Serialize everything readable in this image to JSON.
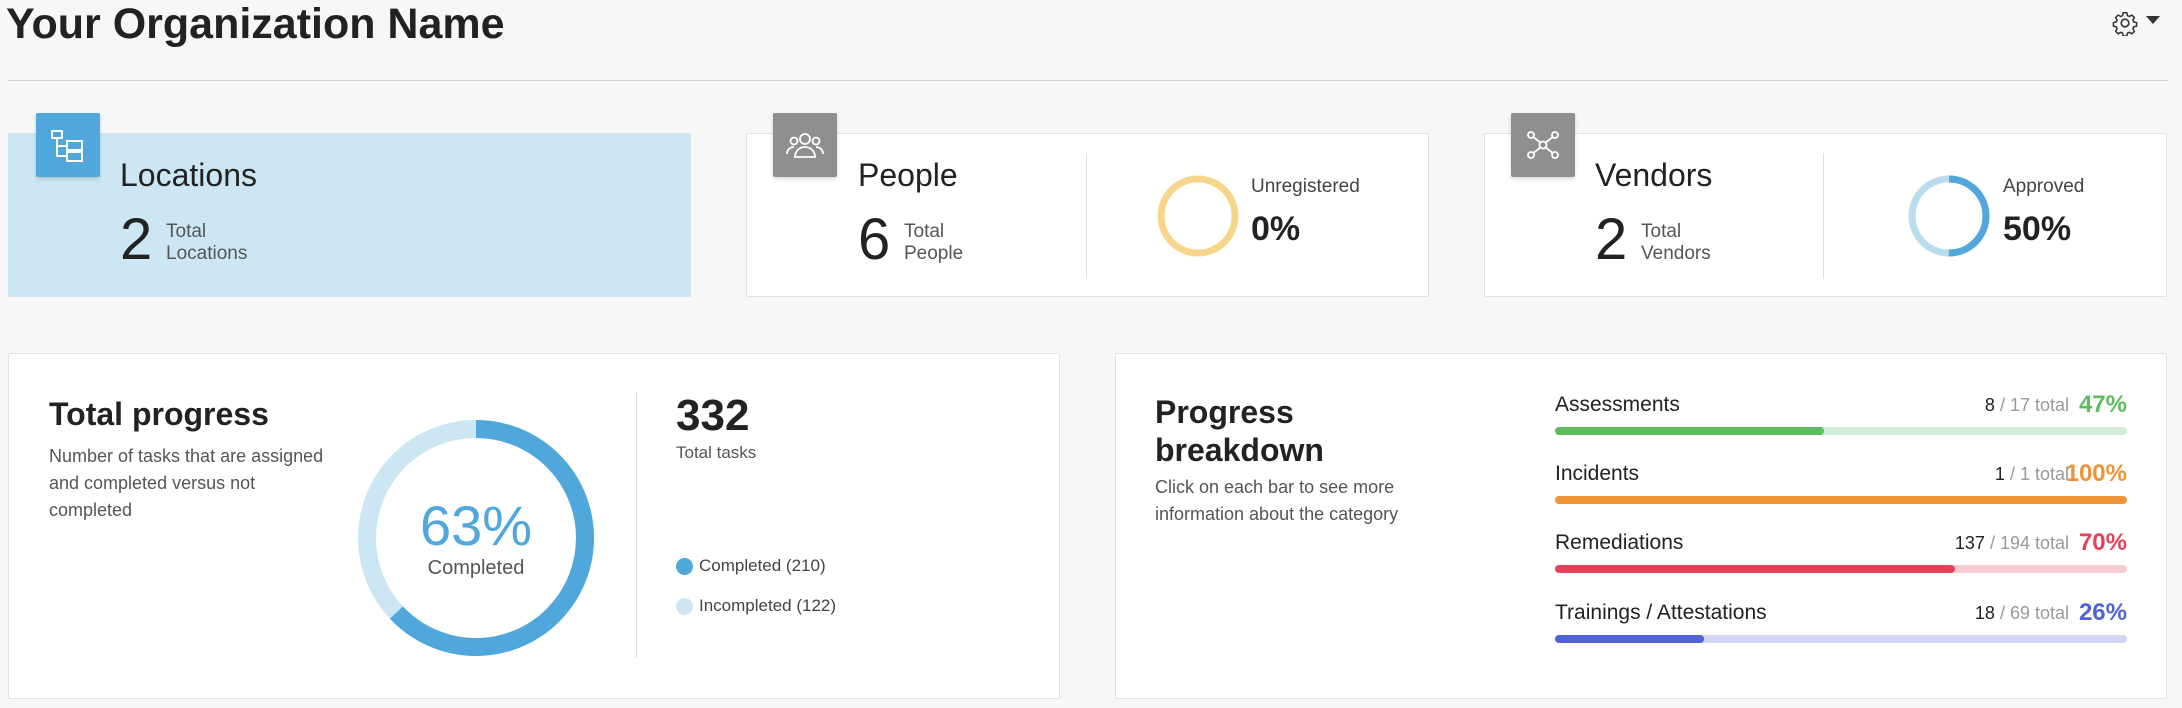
{
  "header": {
    "title": "Your Organization Name"
  },
  "cards": {
    "locations": {
      "title": "Locations",
      "count": "2",
      "count_label": "Total Locations"
    },
    "people": {
      "title": "People",
      "count": "6",
      "count_label": "Total People",
      "metric_label": "Unregistered",
      "metric_value": "0%",
      "metric_fraction": 0,
      "ring_color": "#f7d68c"
    },
    "vendors": {
      "title": "Vendors",
      "count": "2",
      "count_label": "Total Vendors",
      "metric_label": "Approved",
      "metric_value": "50%",
      "metric_fraction": 0.5,
      "ring_color": "#4fa7db",
      "ring_track": "#b9dcee"
    }
  },
  "total_progress": {
    "title": "Total progress",
    "description": "Number of tasks that are assigned and completed versus not completed",
    "donut_pct": "63%",
    "donut_label": "Completed",
    "completed_fraction": 0.63,
    "total_tasks": "332",
    "total_tasks_label": "Total tasks",
    "legend": [
      {
        "label": "Completed (210)",
        "color": "#4fa7db"
      },
      {
        "label": "Incompleted (122)",
        "color": "#cce7f3"
      }
    ]
  },
  "breakdown": {
    "title": "Progress breakdown",
    "description": "Click on each bar to see more information about the category",
    "categories": [
      {
        "name": "Assessments",
        "done": "8",
        "total_text": "/ 17 total",
        "pct": "47%",
        "fraction": 0.47,
        "color": "#5cbd5f",
        "track": "#d3edd4"
      },
      {
        "name": "Incidents",
        "done": "1",
        "total_text": "/ 1 total",
        "pct": "100%",
        "fraction": 1.0,
        "color": "#ef9336",
        "track": "#fbe1c6"
      },
      {
        "name": "Remediations",
        "done": "137",
        "total_text": "/ 194 total",
        "pct": "70%",
        "fraction": 0.7,
        "color": "#e5415a",
        "track": "#f8ccd3"
      },
      {
        "name": "Trainings / Attestations",
        "done": "18",
        "total_text": "/ 69 total",
        "pct": "26%",
        "fraction": 0.26,
        "color": "#4f62d6",
        "track": "#cfd5f2"
      }
    ]
  }
}
